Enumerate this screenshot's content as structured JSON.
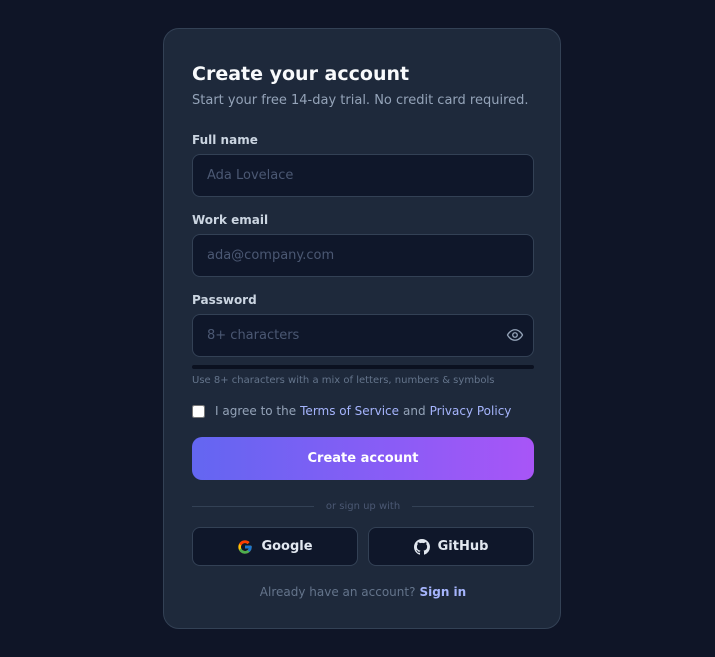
{
  "header": {
    "title": "Create your account",
    "subtitle": "Start your free 14-day trial. No credit card required."
  },
  "form": {
    "full_name": {
      "label": "Full name",
      "placeholder": "Ada Lovelace",
      "value": ""
    },
    "work_email": {
      "label": "Work email",
      "placeholder": "ada@company.com",
      "value": ""
    },
    "password": {
      "label": "Password",
      "placeholder": "8+ characters",
      "value": "",
      "strength_fraction": 0,
      "hint": "Use 8+ characters with a mix of letters, numbers & symbols"
    },
    "agree": {
      "checked": false,
      "prefix": "I agree to the",
      "terms_link": "Terms of Service",
      "conjunction": "and",
      "privacy_link": "Privacy Policy"
    },
    "submit_label": "Create account"
  },
  "social": {
    "divider_text": "or sign up with",
    "google_label": "Google",
    "github_label": "GitHub"
  },
  "footer": {
    "prompt": "Already have an account?",
    "signin_link": "Sign in"
  },
  "colors": {
    "background": "#0f1527",
    "card": "#1e293b",
    "accent_start": "#6366f1",
    "accent_end": "#a855f7",
    "link": "#a5b4fc"
  },
  "icons": {
    "password_toggle": "eye-icon",
    "google": "google-logo-icon",
    "github": "github-logo-icon"
  }
}
